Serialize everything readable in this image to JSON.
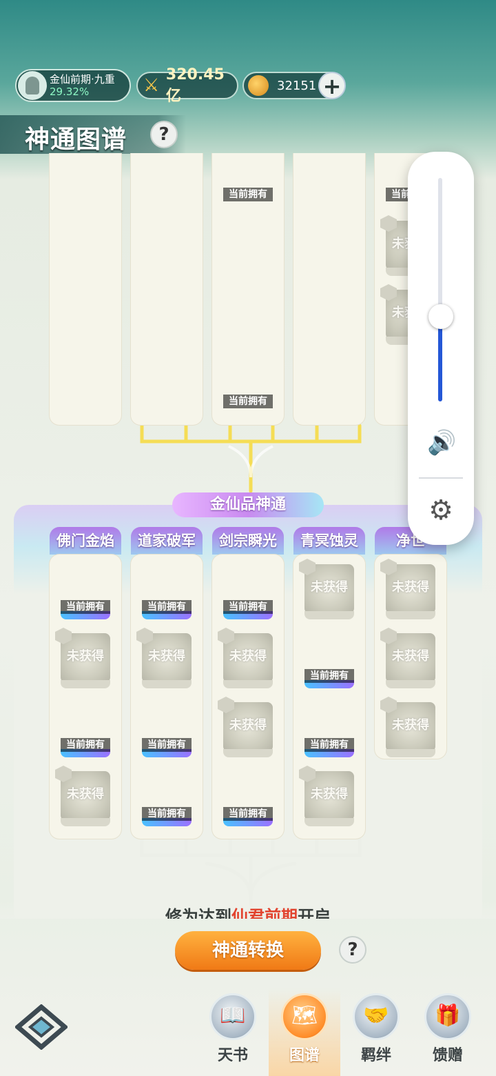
{
  "header": {
    "realm": "金仙前期·九重",
    "progress": "29.32%",
    "power_icon": "crossed-swords-icon",
    "power": "320.45亿",
    "currency_icon": "spirit-coin-icon",
    "currency": "32151",
    "add_label": "+"
  },
  "page": {
    "title": "神通图谱",
    "help_label": "?"
  },
  "top_tier": {
    "columns": [
      {
        "element": "fire",
        "cells": [
          {
            "state": "icon",
            "label": ""
          },
          {
            "state": "icon",
            "label": ""
          },
          {
            "state": "icon",
            "label": ""
          },
          {
            "state": "icon",
            "label": ""
          }
        ]
      },
      {
        "element": "water",
        "cells": [
          {
            "state": "icon",
            "label": ""
          },
          {
            "state": "icon",
            "label": ""
          },
          {
            "state": "icon",
            "label": ""
          },
          {
            "state": "icon",
            "label": ""
          }
        ]
      },
      {
        "element": "gold",
        "cells": [
          {
            "state": "owned",
            "label": "当前拥有"
          },
          {
            "state": "icon",
            "label": ""
          },
          {
            "state": "icon",
            "label": ""
          },
          {
            "state": "owned",
            "label": "当前拥有"
          }
        ]
      },
      {
        "element": "green",
        "cells": [
          {
            "state": "icon",
            "label": ""
          },
          {
            "state": "icon",
            "label": ""
          },
          {
            "state": "icon",
            "label": ""
          },
          {
            "state": "icon",
            "label": ""
          }
        ]
      },
      {
        "element": "purple",
        "cells": [
          {
            "state": "owned",
            "label": "当前拥有"
          },
          {
            "state": "locked",
            "label": "未获得"
          },
          {
            "state": "locked",
            "label": "未获得"
          }
        ]
      }
    ]
  },
  "tier2": {
    "section_title": "金仙品神通",
    "columns": [
      {
        "name": "佛门金焰",
        "element": "fire",
        "cells": [
          {
            "state": "owned",
            "label": "当前拥有"
          },
          {
            "state": "locked",
            "label": "未获得"
          },
          {
            "state": "owned",
            "label": "当前拥有"
          },
          {
            "state": "locked",
            "label": "未获得"
          }
        ]
      },
      {
        "name": "道家破军",
        "element": "water",
        "cells": [
          {
            "state": "owned",
            "label": "当前拥有"
          },
          {
            "state": "locked",
            "label": "未获得"
          },
          {
            "state": "owned",
            "label": "当前拥有"
          },
          {
            "state": "owned",
            "label": "当前拥有"
          }
        ]
      },
      {
        "name": "剑宗瞬光",
        "element": "gold",
        "cells": [
          {
            "state": "owned",
            "label": "当前拥有"
          },
          {
            "state": "locked",
            "label": "未获得"
          },
          {
            "state": "locked",
            "label": "未获得"
          },
          {
            "state": "owned",
            "label": "当前拥有"
          }
        ]
      },
      {
        "name": "青冥蚀灵",
        "element": "green",
        "cells": [
          {
            "state": "locked",
            "label": "未获得"
          },
          {
            "state": "owned",
            "label": "当前拥有"
          },
          {
            "state": "owned",
            "label": "当前拥有"
          },
          {
            "state": "locked",
            "label": "未获得"
          }
        ]
      },
      {
        "name": "净世",
        "element": "purple",
        "cells": [
          {
            "state": "locked",
            "label": "未获得"
          },
          {
            "state": "locked",
            "label": "未获得"
          },
          {
            "state": "locked",
            "label": "未获得"
          }
        ]
      }
    ],
    "unlock_pre": "修为达到",
    "unlock_hl": "仙君前期",
    "unlock_post": "开启"
  },
  "actions": {
    "convert_label": "神通转换",
    "help_label": "?"
  },
  "nav": {
    "logo_icon": "game-logo-icon",
    "items": [
      {
        "label": "天书",
        "icon": "book-icon",
        "glyph": "📖",
        "active": false
      },
      {
        "label": "图谱",
        "icon": "map-scroll-icon",
        "glyph": "🗺",
        "active": true
      },
      {
        "label": "羁绊",
        "icon": "handshake-icon",
        "glyph": "🤝",
        "active": false
      },
      {
        "label": "馈赠",
        "icon": "gift-bag-icon",
        "glyph": "🎁",
        "active": false
      }
    ]
  },
  "volume_overlay": {
    "level": 0.38,
    "speaker_icon": "speaker-icon",
    "settings_icon": "gear-icon",
    "accent": "#2457d6"
  },
  "colors": {
    "fire": "#e8485a",
    "water": "#2f9ec8",
    "gold": "#d29a1d",
    "green": "#21a772",
    "purple": "#9a6ad8",
    "owned_bar": "#e85b78",
    "button_orange": "#f07a16"
  }
}
